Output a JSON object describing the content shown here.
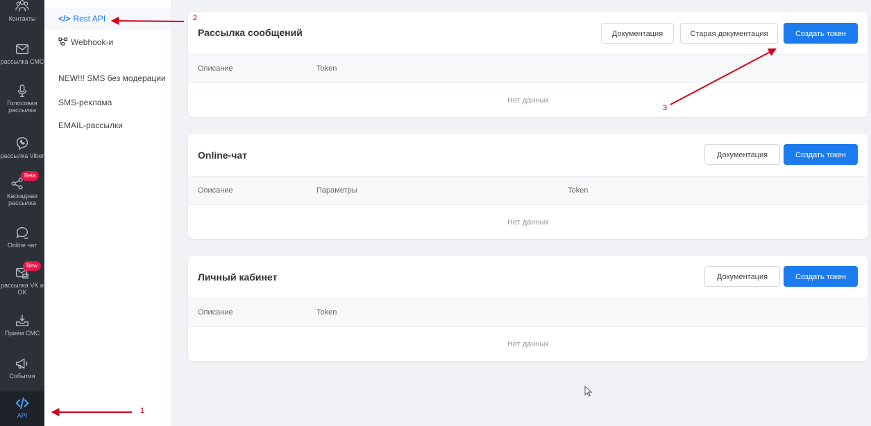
{
  "rail": {
    "items": [
      {
        "label": "Контакты",
        "icon": "contacts-icon"
      },
      {
        "label": "рассылка СМС",
        "icon": "mail-icon"
      },
      {
        "label": "Голосовая рассылка",
        "icon": "microphone-icon"
      },
      {
        "label": "рассылка Viber",
        "icon": "viber-icon"
      },
      {
        "label": "Каскадная рассылка",
        "icon": "cascade-icon",
        "badge": "Beta"
      },
      {
        "label": "Online чат",
        "icon": "chat-icon"
      },
      {
        "label": "рассылка VK и OK",
        "icon": "vk-mail-icon",
        "badge": "New"
      },
      {
        "label": "Приём СМС",
        "icon": "inbox-icon"
      },
      {
        "label": "События",
        "icon": "megaphone-icon"
      },
      {
        "label": "API",
        "icon": "code-icon",
        "active": true
      }
    ]
  },
  "submenu": {
    "items": [
      {
        "label": "Rest API",
        "icon_text": "</>",
        "active": true
      },
      {
        "label": "Webhook-и"
      },
      {
        "label": "NEW!!! SMS без модерации"
      },
      {
        "label": "SMS-реклама"
      },
      {
        "label": "EMAIL-рассылки"
      }
    ]
  },
  "cards": [
    {
      "title": "Рассылка сообщений",
      "buttons": [
        "Документация",
        "Старая документация",
        "Создать токен"
      ],
      "columns": [
        "Описание",
        "Token"
      ],
      "empty": "Нет данных"
    },
    {
      "title": "Online-чат",
      "buttons": [
        "Документация",
        "Создать токен"
      ],
      "columns": [
        "Описание",
        "Параметры",
        "Token"
      ],
      "empty": "Нет данных"
    },
    {
      "title": "Личный кабинет",
      "buttons": [
        "Документация",
        "Создать токен"
      ],
      "columns": [
        "Описание",
        "Token"
      ],
      "empty": "Нет данных"
    }
  ],
  "annotations": {
    "a1": "1",
    "a2": "2",
    "a3": "3"
  },
  "colors": {
    "accent": "#1d7bf0",
    "annotation": "#d0021b",
    "rail": "#2c3138",
    "badge": "#e8174a"
  }
}
